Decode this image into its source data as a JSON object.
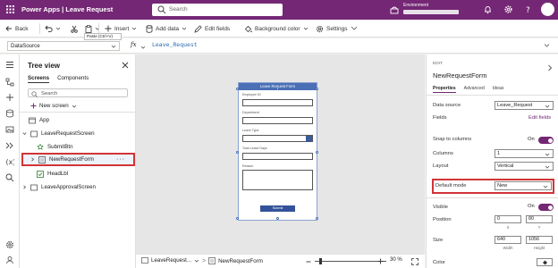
{
  "app": {
    "title": "Power Apps | Leave Request"
  },
  "topbar": {
    "search_placeholder": "Search",
    "environment_label": "Environment",
    "accent": "#742774"
  },
  "command_bar": {
    "back": "Back",
    "insert": "Insert",
    "add_data": "Add data",
    "edit_fields": "Edit fields",
    "background_color": "Background color",
    "settings": "Settings",
    "paste_tooltip": "Paste (Ctrl+V)"
  },
  "formula_bar": {
    "property": "DataSource",
    "fx": "fx",
    "formula": "Leave_Request"
  },
  "tree_view": {
    "title": "Tree view",
    "tabs": [
      "Screens",
      "Components"
    ],
    "search_placeholder": "Search",
    "new_screen": "New screen",
    "nodes": {
      "app": "App",
      "leave_request_screen": "LeaveRequestScreen",
      "submit_btn": "SubmitBtn",
      "new_request_form": "NewRequestForm",
      "head_lbl": "HeadLbl",
      "leave_approval_screen": "LeaveApprovalScreen"
    }
  },
  "canvas": {
    "form_header": "Leave Request Form",
    "fields": [
      "Employee ID",
      "Department",
      "Leave Type",
      "Total Leave Days",
      "Reason"
    ],
    "submit_label": "Submit"
  },
  "status_bar": {
    "screen": "LeaveRequest...",
    "control": "NewRequestForm",
    "zoom": "30",
    "zoom_unit": "%"
  },
  "properties": {
    "edit_label": "EDIT",
    "control_name": "NewRequestForm",
    "tabs": [
      "Properties",
      "Advanced",
      "Ideas"
    ],
    "data_source_label": "Data source",
    "data_source_value": "Leave_Request",
    "fields_label": "Fields",
    "edit_fields_link": "Edit fields",
    "snap_label": "Snap to columns",
    "snap_state": "On",
    "columns_label": "Columns",
    "columns_value": "1",
    "layout_label": "Layout",
    "layout_value": "Vertical",
    "default_mode_label": "Default mode",
    "default_mode_value": "New",
    "visible_label": "Visible",
    "visible_state": "On",
    "position_label": "Position",
    "pos_x": "0",
    "pos_y": "80",
    "pos_x_cap": "X",
    "pos_y_cap": "Y",
    "size_label": "Size",
    "width": "640",
    "height": "1056",
    "width_cap": "Width",
    "height_cap": "Height",
    "color_label": "Color"
  }
}
